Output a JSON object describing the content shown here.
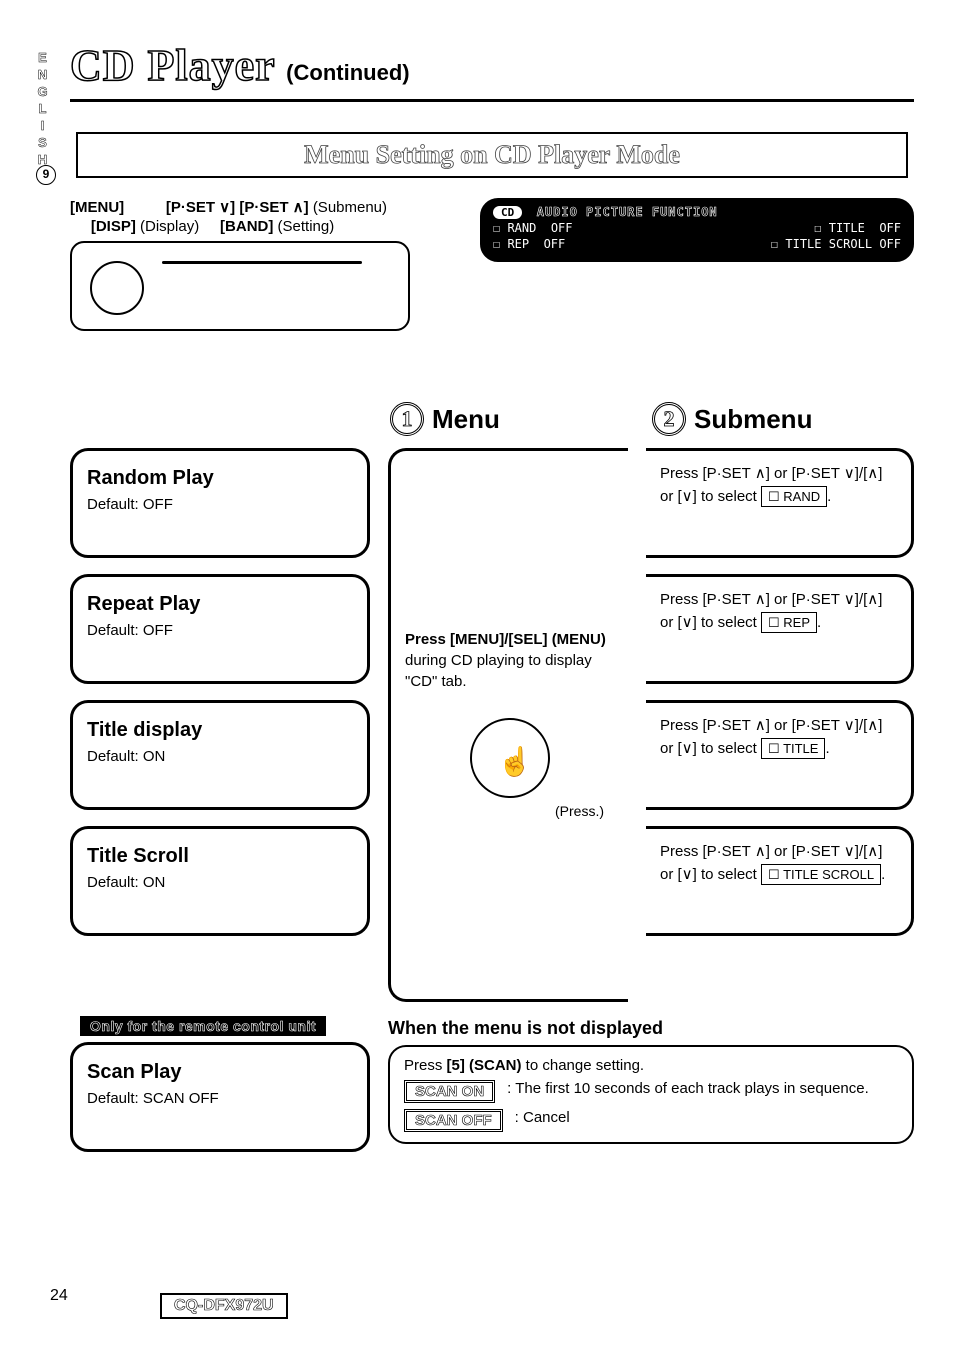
{
  "lang": "ENGLISH",
  "circled_side": "9",
  "title": {
    "main": "CD Player",
    "continued": "(Continued)"
  },
  "banner": "Menu Setting on CD Player Mode",
  "device_labels": {
    "line1": {
      "menu": "[MENU]",
      "pset": "[P·SET ∨] [P·SET ∧]",
      "pset_note": "(Submenu)"
    },
    "line2": {
      "disp": "[DISP]",
      "disp_note": "(Display)",
      "band": "[BAND]",
      "band_note": "(Setting)"
    }
  },
  "lcd": {
    "tab": "CD",
    "header": "AUDIO PICTURE FUNCTION",
    "r1a": "☐ RAND",
    "r1a_v": "OFF",
    "r1b": "☐ TITLE",
    "r1b_v": "OFF",
    "r2a": "☐ REP",
    "r2a_v": "OFF",
    "r2b": "☐ TITLE SCROLL",
    "r2b_v": "OFF"
  },
  "steps": {
    "one": "1",
    "one_label": "Menu",
    "two": "2",
    "two_label": "Submenu"
  },
  "features": [
    {
      "title": "Random Play",
      "default": "Default: OFF"
    },
    {
      "title": "Repeat Play",
      "default": "Default: OFF"
    },
    {
      "title": "Title display",
      "default": "Default: ON"
    },
    {
      "title": "Title Scroll",
      "default": "Default: ON"
    }
  ],
  "menu_instruction": {
    "line1": "Press [MENU]/[SEL] (MENU)",
    "line2": "during CD playing to display",
    "line3": "\"CD\" tab.",
    "press": "(Press.)"
  },
  "submenu": [
    {
      "pre": "Press [P·SET ∧] or [P·SET ∨]/[∧] or [∨] to select",
      "kbd": "☐ RAND"
    },
    {
      "pre": "Press [P·SET ∧] or [P·SET ∨]/[∧] or [∨] to select",
      "kbd": "☐ REP"
    },
    {
      "pre": "Press [P·SET ∧] or [P·SET ∨]/[∧] or [∨] to select",
      "kbd": "☐ TITLE"
    },
    {
      "pre": "Press [P·SET ∧] or [P·SET ∨]/[∧] or [∨] to select",
      "kbd": "☐ TITLE SCROLL"
    }
  ],
  "remote_badge": "Only for the remote control unit",
  "scan": {
    "title": "Scan Play",
    "default": "Default: SCAN OFF"
  },
  "nodisp": {
    "heading": "When the menu is not displayed",
    "press": "Press [5] (SCAN) to change setting.",
    "on": "SCAN ON",
    "on_desc": ": The first 10 seconds of each track plays in sequence.",
    "off": "SCAN OFF",
    "off_desc": ": Cancel"
  },
  "page_number": "24",
  "model": "CQ-DFX972U"
}
